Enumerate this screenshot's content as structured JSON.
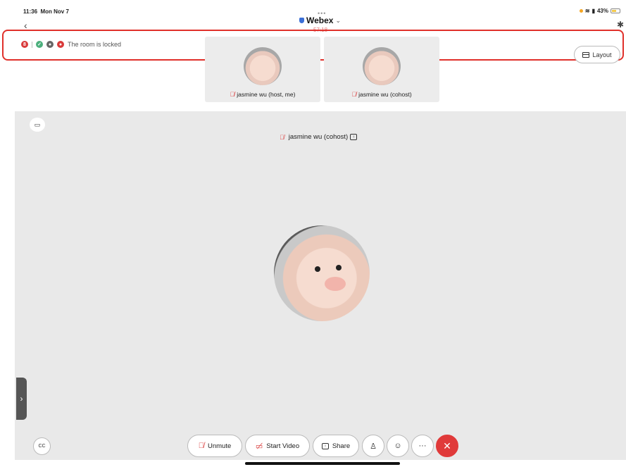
{
  "status": {
    "time": "11:36",
    "date": "Mon Nov 7",
    "battery": "43%"
  },
  "header": {
    "title": "Webex",
    "timer": "57:18"
  },
  "banner": {
    "text": "The room is locked",
    "count": "8"
  },
  "layout_label": "Layout",
  "thumbnails": [
    {
      "name": "jasmine wu (host, me)"
    },
    {
      "name": "jasmine wu (cohost)"
    }
  ],
  "stage": {
    "name": "jasmine wu (cohost)"
  },
  "controls": {
    "unmute": "Unmute",
    "start_video": "Start Video",
    "share": "Share"
  },
  "colors": {
    "accent_red": "#e03a3a",
    "highlight_border": "#e0302a",
    "stage_bg": "#e9e9e9"
  },
  "icons": [
    "back-icon",
    "bluetooth-icon",
    "wifi-icon",
    "battery-icon",
    "lock-icon",
    "mic-muted-icon",
    "share-icon",
    "participants-icon",
    "reactions-icon",
    "more-icon",
    "end-call-icon",
    "captions-icon",
    "pip-icon"
  ]
}
